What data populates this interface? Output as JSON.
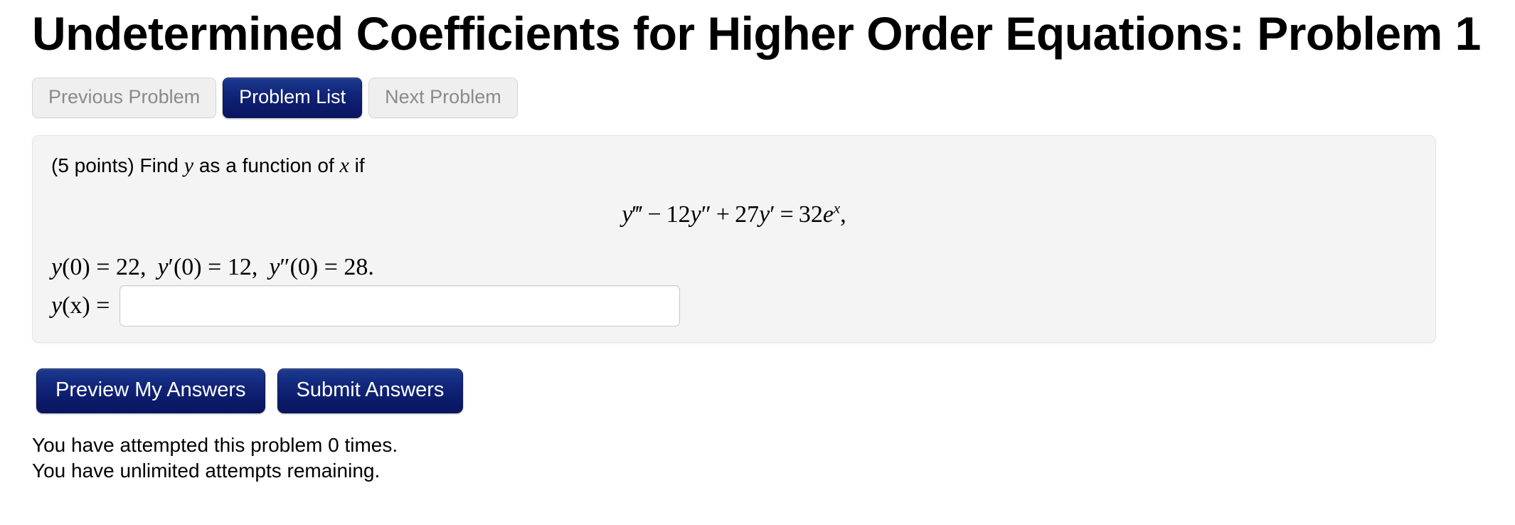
{
  "page": {
    "title": "Undetermined Coefficients for Higher Order Equations: Problem 1"
  },
  "nav": {
    "previous_label": "Previous Problem",
    "problem_list_label": "Problem List",
    "next_label": "Next Problem"
  },
  "problem": {
    "points_prompt_prefix": "(5 points) Find",
    "prompt_var_1": "y",
    "points_prompt_middle": "as a function of",
    "prompt_var_2": "x",
    "points_prompt_suffix": "if",
    "equation_plain": "y''' - 12y'' + 27y' = 32e^x,",
    "equation": {
      "lhs_var": "y",
      "lhs_primes": "‴",
      "op1": "−",
      "term2_coef": "12",
      "term2_var": "y",
      "term2_primes": "″",
      "op2": "+",
      "term3_coef": "27",
      "term3_var": "y",
      "term3_primes": "′",
      "equals": "=",
      "rhs_coef": "32",
      "rhs_base": "e",
      "rhs_exponent": "x",
      "trailing_comma": ","
    },
    "initial_conditions_plain": "y(0) = 22,  y'(0) = 12,  y''(0) = 28.",
    "initial_conditions": [
      {
        "var": "y",
        "primes": "",
        "arg": "(0)",
        "equals": "=",
        "value": "22",
        "sep": ","
      },
      {
        "var": "y",
        "primes": "′",
        "arg": "(0)",
        "equals": "=",
        "value": "12",
        "sep": ","
      },
      {
        "var": "y",
        "primes": "″",
        "arg": "(0)",
        "equals": "=",
        "value": "28",
        "sep": "."
      }
    ],
    "answer_label_var": "y",
    "answer_label_arg": "(x)",
    "answer_label_equals": "=",
    "answer_value": "",
    "answer_placeholder": ""
  },
  "actions": {
    "preview_label": "Preview My Answers",
    "submit_label": "Submit Answers"
  },
  "status": {
    "attempted_line": "You have attempted this problem 0 times.",
    "remaining_line": "You have unlimited attempts remaining.",
    "attempt_count": "0"
  },
  "colors": {
    "primary_button": "#0c1b6b",
    "panel_background": "#f4f4f4",
    "panel_border": "#e6e6e6",
    "disabled_text": "#8a8a8a",
    "page_background": "#ffffff"
  }
}
